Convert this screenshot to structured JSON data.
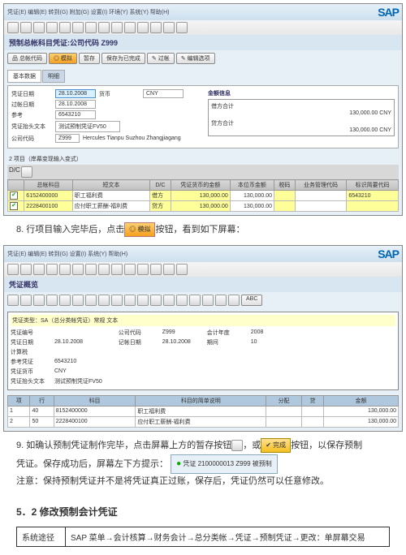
{
  "screen1": {
    "menu": "凭证(E)  编辑(E)  转到(G)  附加(G)  设置(I)  环境(Y)  系统(Y)  帮助(H)",
    "title": "预制总帐科目凭证:公司代码 Z999",
    "btnbar": [
      "品 总帐代码",
      "◎ 模拟",
      "暂存",
      "保存为已完成",
      "✎ 过帐",
      "✎ 编辑选项"
    ],
    "tabs": [
      "基本数据",
      "明细"
    ],
    "form": {
      "date_lbl": "凭证日期",
      "date_val": "28.10.2008",
      "curr_lbl": "货币",
      "curr_val": "CNY",
      "post_lbl": "过帐日期",
      "post_val": "28.10.2008",
      "ref_lbl": "参考",
      "ref_val": "6543210",
      "hdr_lbl": "凭证抬头文本",
      "hdr_val": "测试预制凭证FV50",
      "co_lbl": "公司代码",
      "co_val": "Z999",
      "co_name": "Hercules Tianpu Suzhou Zhangjiagang"
    },
    "amounts": {
      "title": "金额信息",
      "debit_lbl": "借方合计",
      "debit_val": "130,000.00",
      "debit_cur": "CNY",
      "credit_lbl": "贷方合计",
      "credit_val": "130,000.00",
      "credit_cur": "CNY"
    },
    "grid": {
      "caption": "2 项目（岸幕变现输入变式）",
      "lbl": "D/C",
      "headers": [
        "",
        "总帐科目",
        "短文本",
        "D/C",
        "凭证货币的金额",
        "本位币金额",
        "税码",
        "业务管理代码",
        "标识简要代码"
      ],
      "rows": [
        {
          "chk": "✔",
          "acct": "6152400000",
          "txt": "职工福利费",
          "dc": "借方",
          "amt": "130,000.00",
          "loc": "130,000.00",
          "tax": "",
          "bm": "",
          "id": "6543210"
        },
        {
          "chk": "✔",
          "acct": "2228400100",
          "txt": "应付职工薪酬-福利费",
          "dc": "贷方",
          "amt": "130,000.00",
          "loc": "130,000.00",
          "tax": "",
          "bm": "",
          "id": ""
        }
      ]
    }
  },
  "note8": {
    "num": "8.",
    "body_a": "行项目输入完毕后，点击",
    "btn": "◎ 模拟",
    "body_b": "按钮，看到如下屏幕："
  },
  "screen2": {
    "menu": "凭证(E)  编辑(E)  转到(G)  设置(I)  系统(Y)  帮助(H)",
    "title": "凭证概览",
    "box_title": "凭证类型：SA（总分类帐凭证）常规 文本",
    "fields": {
      "doc_lbl": "凭证编号",
      "co_lbl": "公司代码",
      "co_val": "Z999",
      "fy_lbl": "会计年度",
      "fy_val": "2008",
      "dd_lbl": "凭证日期",
      "dd_val": "28.10.2008",
      "pd_lbl": "记帐日期",
      "pd_val": "28.10.2008",
      "per_lbl": "期间",
      "per_val": "10",
      "calc_lbl": "计算税",
      "ref_lbl": "参考凭证",
      "ref_val": "6543210",
      "cur_lbl": "凭证货币",
      "cur_val": "CNY",
      "hdr_lbl": "凭证抬头文本",
      "hdr_val": "测试预制凭证FV50"
    },
    "grid": {
      "headers": [
        "项",
        "行",
        "科目",
        "科目的简单说明",
        "分配",
        "贷",
        "金额"
      ],
      "rows": [
        {
          "p": "1",
          "ln": "40",
          "acct": "8152400000",
          "txt": "职工福利费",
          "asg": "",
          "cd": "",
          "amt": "130,000.00"
        },
        {
          "p": "2",
          "ln": "50",
          "acct": "2228400100",
          "txt": "应付职工薪酬-福利费",
          "asg": "",
          "cd": "",
          "amt": "130,000.00"
        }
      ]
    }
  },
  "note9": {
    "num": "9.",
    "a": "如确认预制凭证制作完毕，点击屏幕上方的暂存按钮",
    "b": "，或",
    "done": "✔ 完成",
    "c": "按钮，以保存预制",
    "d": "凭证。保存成功后，屏幕左下方提示：",
    "status": "凭证 2100000013 Z999 被预制",
    "status_icon": "●",
    "notice_lbl": "注意：",
    "notice": "保持预制凭证并不是将凭证真正过账，保存后，凭证仍然可以任意修改。"
  },
  "section52": "5．2  修改预制会计凭证",
  "route": {
    "label": "系统途径",
    "path": "SAP 菜单→会计核算→财务会计→总分类帐→凭证→预制凭证→更改：单屏幕交易"
  }
}
